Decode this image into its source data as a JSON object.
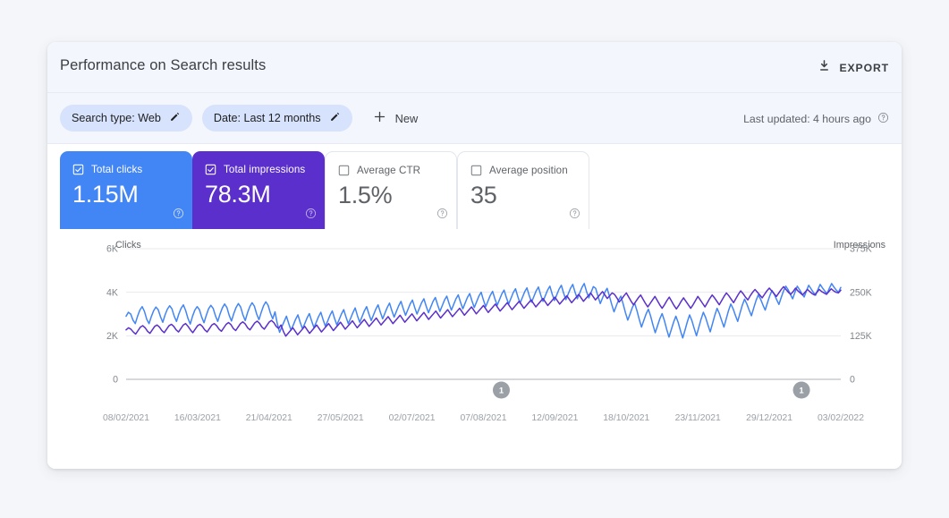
{
  "header": {
    "title": "Performance on Search results",
    "export_label": "EXPORT",
    "export_icon": "download-icon"
  },
  "filters": {
    "chips": [
      {
        "label": "Search type: Web",
        "icon": "pencil-icon"
      },
      {
        "label": "Date: Last 12 months",
        "icon": "pencil-icon"
      }
    ],
    "new_label": "New",
    "new_icon": "plus-icon",
    "last_updated": "Last updated: 4 hours ago",
    "help_icon": "help-circle-icon"
  },
  "metrics": [
    {
      "label": "Total clicks",
      "value": "1.15M",
      "checked": true,
      "style": "blue",
      "color": "#4285F4",
      "help_icon": "help-circle-icon"
    },
    {
      "label": "Total impressions",
      "value": "78.3M",
      "checked": true,
      "style": "purple",
      "color": "#5B2FCB",
      "help_icon": "help-circle-icon"
    },
    {
      "label": "Average CTR",
      "value": "1.5%",
      "checked": false,
      "style": "plain",
      "color": "#FFFFFF",
      "help_icon": "help-circle-icon"
    },
    {
      "label": "Average position",
      "value": "35",
      "checked": false,
      "style": "plain",
      "color": "#FFFFFF",
      "help_icon": "help-circle-icon"
    }
  ],
  "chart_data": {
    "type": "line",
    "title": "",
    "left_axis_label": "Clicks",
    "right_axis_label": "Impressions",
    "left_ticks": [
      "0",
      "2K",
      "4K",
      "6K"
    ],
    "left_values": [
      0,
      2000,
      4000,
      6000
    ],
    "right_ticks": [
      "0",
      "125K",
      "250K",
      "375K"
    ],
    "right_values": [
      0,
      125000,
      250000,
      375000
    ],
    "ylim_left": [
      0,
      6000
    ],
    "ylim_right": [
      0,
      375000
    ],
    "grid": true,
    "legend": "none",
    "x_tick_labels": [
      "08/02/2021",
      "16/03/2021",
      "21/04/2021",
      "27/05/2021",
      "02/07/2021",
      "07/08/2021",
      "12/09/2021",
      "18/10/2021",
      "23/11/2021",
      "29/12/2021",
      "03/02/2022"
    ],
    "annotations": [
      {
        "label": "1",
        "x_fraction": 0.525
      },
      {
        "label": "1",
        "x_fraction": 0.945
      }
    ],
    "series": [
      {
        "name": "Clicks",
        "color": "#4285F4",
        "axis": "left",
        "values": [
          2900,
          3080,
          3000,
          2720,
          2560,
          2900,
          3180,
          3340,
          3120,
          2760,
          2560,
          2880,
          3150,
          3320,
          3200,
          2880,
          2620,
          2960,
          3220,
          3380,
          3240,
          2900,
          2660,
          3000,
          3260,
          3420,
          3160,
          2800,
          2540,
          2900,
          3180,
          3340,
          3200,
          2860,
          2600,
          2940,
          3240,
          3400,
          3260,
          2920,
          2660,
          3000,
          3280,
          3460,
          3300,
          2940,
          2680,
          3020,
          3300,
          3480,
          3320,
          2960,
          2700,
          3060,
          3340,
          3520,
          3360,
          3000,
          2740,
          3080,
          3380,
          3560,
          3400,
          3040,
          2780,
          3100,
          2560,
          2160,
          2420,
          2660,
          2900,
          2560,
          2260,
          2500,
          2760,
          2960,
          2620,
          2320,
          2560,
          2820,
          3020,
          2680,
          2380,
          2620,
          2880,
          3080,
          2740,
          2440,
          2680,
          2940,
          3140,
          2800,
          2500,
          2740,
          3000,
          3200,
          2860,
          2560,
          2800,
          3060,
          3280,
          2920,
          2620,
          2880,
          3140,
          3340,
          3000,
          2700,
          2960,
          3220,
          3420,
          3080,
          2780,
          3040,
          3300,
          3500,
          3160,
          2860,
          3120,
          3380,
          3580,
          3240,
          2940,
          3200,
          3460,
          3640,
          3300,
          3000,
          3260,
          3520,
          3700,
          3360,
          3060,
          3320,
          3580,
          3760,
          3420,
          3120,
          3380,
          3640,
          3820,
          3480,
          3180,
          3440,
          3700,
          3880,
          3540,
          3240,
          3500,
          3760,
          3940,
          3600,
          3300,
          3560,
          3820,
          4000,
          3640,
          3340,
          3600,
          3860,
          4040,
          3700,
          3400,
          3660,
          3920,
          4100,
          3760,
          3460,
          3720,
          3980,
          4160,
          3800,
          3500,
          3760,
          4020,
          4200,
          3840,
          3540,
          3800,
          4060,
          4240,
          3880,
          3580,
          3840,
          4100,
          4280,
          3920,
          3620,
          3880,
          4140,
          4320,
          3960,
          3660,
          3920,
          4180,
          4360,
          4000,
          3700,
          3960,
          4220,
          4400,
          4040,
          3740,
          4000,
          4260,
          4180,
          3820,
          3480,
          3740,
          4000,
          4180,
          3820,
          3440,
          3100,
          3380,
          3640,
          3820,
          3460,
          3060,
          2720,
          3000,
          3300,
          3500,
          3160,
          2760,
          2400,
          2700,
          3000,
          3220,
          2900,
          2500,
          2140,
          2460,
          2780,
          3020,
          2700,
          2300,
          1940,
          2280,
          2620,
          2900,
          2620,
          2240,
          1900,
          2260,
          2640,
          2960,
          2700,
          2340,
          2000,
          2380,
          2760,
          3080,
          2840,
          2500,
          2180,
          2560,
          2940,
          3260,
          3020,
          2700,
          2400,
          2780,
          3160,
          3460,
          3240,
          2940,
          2660,
          3040,
          3400,
          3680,
          3460,
          3180,
          2920,
          3280,
          3620,
          3880,
          3680,
          3420,
          3180,
          3520,
          3840,
          4080,
          3900,
          3660,
          3440,
          3760,
          4060,
          4280,
          4120,
          3900,
          3700,
          4000,
          4280,
          4120,
          3940,
          3780,
          4060,
          4320,
          4160,
          4000,
          3860,
          4120,
          4360,
          4200,
          4060,
          3940,
          4180,
          4400,
          4240,
          4100,
          4000,
          4220
        ]
      },
      {
        "name": "Impressions",
        "color": "#5B2FCB",
        "axis": "right",
        "values": [
          142000,
          148000,
          144000,
          136000,
          130000,
          140000,
          150000,
          154000,
          148000,
          138000,
          132000,
          142000,
          152000,
          156000,
          150000,
          140000,
          134000,
          144000,
          154000,
          158000,
          152000,
          142000,
          136000,
          146000,
          156000,
          160000,
          152000,
          142000,
          134000,
          144000,
          154000,
          158000,
          152000,
          142000,
          136000,
          146000,
          156000,
          160000,
          154000,
          144000,
          138000,
          148000,
          158000,
          163000,
          157000,
          146000,
          140000,
          150000,
          160000,
          165000,
          159000,
          148000,
          142000,
          152000,
          162000,
          167000,
          161000,
          150000,
          144000,
          154000,
          164000,
          169000,
          163000,
          152000,
          146000,
          156000,
          138000,
          124000,
          132000,
          140000,
          148000,
          138000,
          128000,
          136000,
          144000,
          152000,
          142000,
          132000,
          140000,
          148000,
          156000,
          146000,
          136000,
          144000,
          152000,
          160000,
          150000,
          140000,
          148000,
          156000,
          164000,
          154000,
          144000,
          152000,
          160000,
          168000,
          158000,
          148000,
          156000,
          164000,
          172000,
          162000,
          152000,
          160000,
          168000,
          176000,
          166000,
          156000,
          164000,
          172000,
          180000,
          170000,
          160000,
          168000,
          176000,
          184000,
          174000,
          164000,
          172000,
          180000,
          188000,
          178000,
          168000,
          176000,
          184000,
          192000,
          182000,
          172000,
          180000,
          188000,
          196000,
          186000,
          176000,
          184000,
          192000,
          200000,
          190000,
          180000,
          188000,
          196000,
          204000,
          194000,
          184000,
          192000,
          200000,
          208000,
          198000,
          188000,
          196000,
          204000,
          212000,
          202000,
          192000,
          200000,
          208000,
          216000,
          206000,
          196000,
          204000,
          212000,
          220000,
          210000,
          200000,
          208000,
          216000,
          224000,
          214000,
          204000,
          212000,
          220000,
          228000,
          218000,
          208000,
          216000,
          224000,
          232000,
          222000,
          212000,
          220000,
          228000,
          236000,
          226000,
          216000,
          224000,
          232000,
          240000,
          230000,
          220000,
          228000,
          236000,
          244000,
          234000,
          224000,
          232000,
          240000,
          248000,
          238000,
          228000,
          236000,
          244000,
          252000,
          242000,
          232000,
          240000,
          248000,
          244000,
          234000,
          222000,
          230000,
          240000,
          248000,
          236000,
          224000,
          214000,
          224000,
          234000,
          242000,
          230000,
          218000,
          208000,
          218000,
          228000,
          238000,
          226000,
          214000,
          204000,
          214000,
          226000,
          236000,
          224000,
          212000,
          202000,
          212000,
          224000,
          234000,
          224000,
          214000,
          204000,
          214000,
          226000,
          238000,
          228000,
          218000,
          208000,
          220000,
          232000,
          242000,
          234000,
          224000,
          214000,
          226000,
          238000,
          248000,
          240000,
          230000,
          220000,
          232000,
          244000,
          254000,
          246000,
          236000,
          228000,
          240000,
          250000,
          258000,
          250000,
          242000,
          234000,
          244000,
          254000,
          262000,
          254000,
          246000,
          238000,
          248000,
          258000,
          266000,
          258000,
          250000,
          244000,
          252000,
          262000,
          254000,
          248000,
          242000,
          250000,
          258000,
          252000,
          246000,
          242000,
          250000,
          258000,
          252000,
          248000,
          244000,
          252000,
          260000,
          254000,
          250000,
          248000,
          256000
        ]
      }
    ]
  }
}
